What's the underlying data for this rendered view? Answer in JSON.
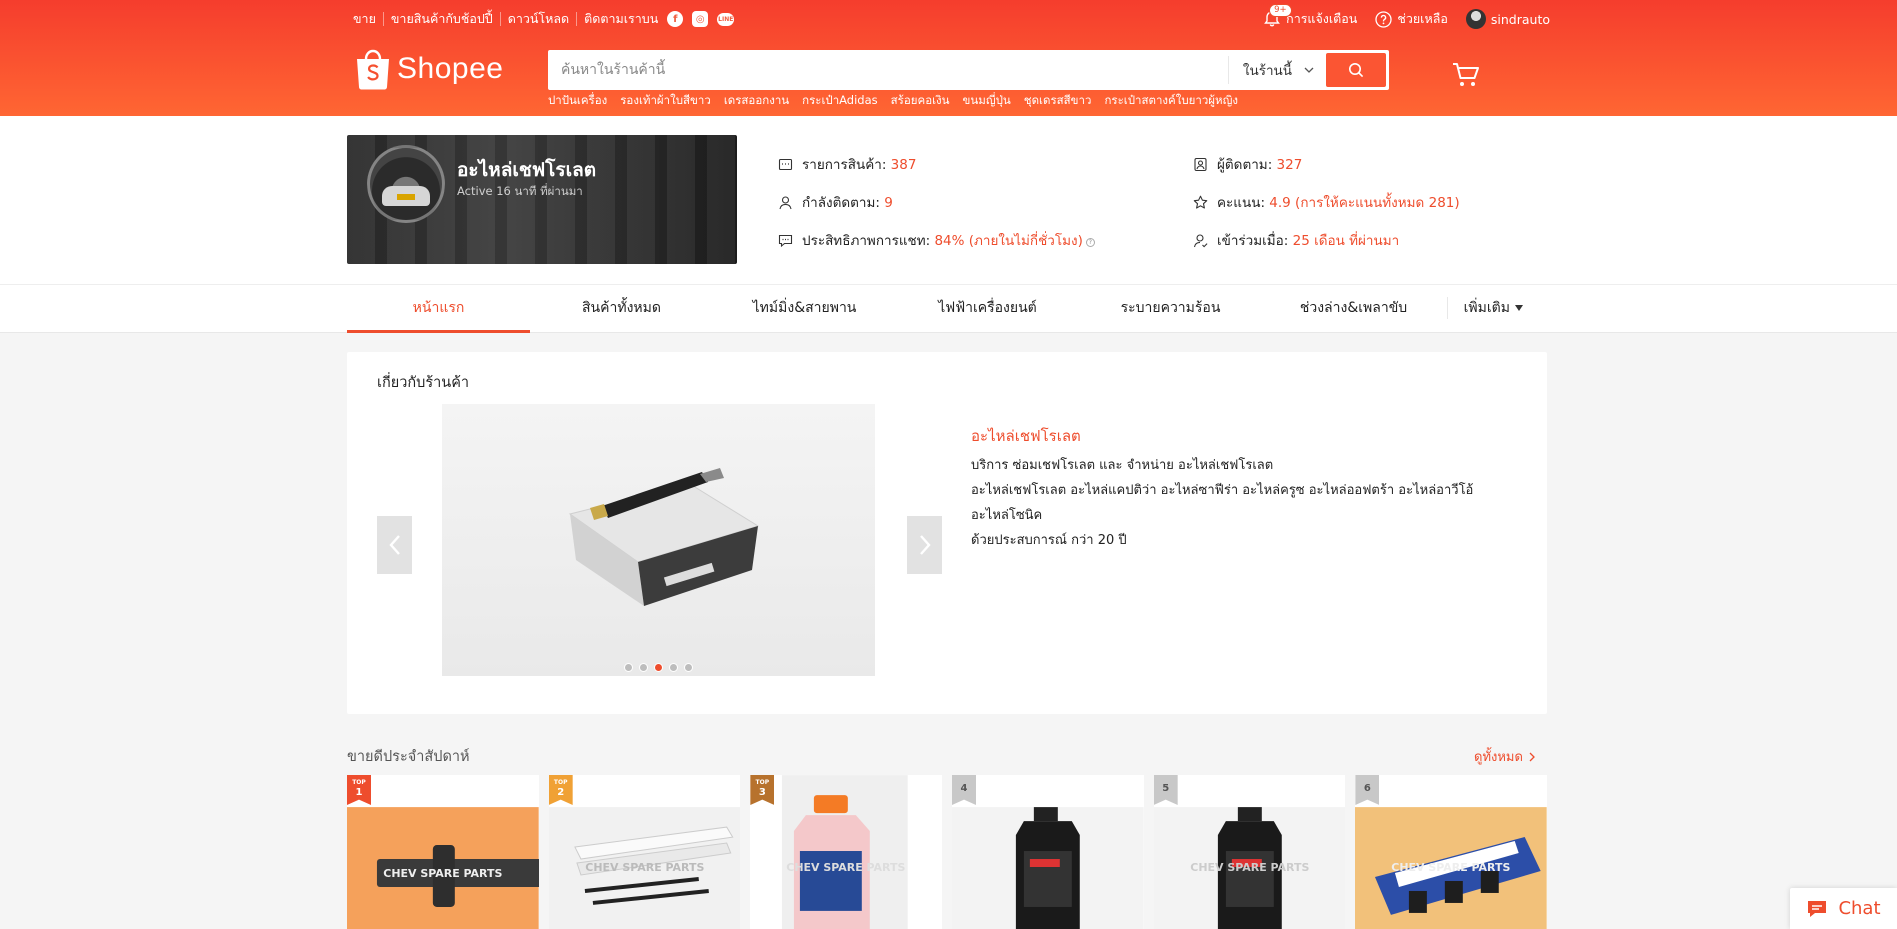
{
  "topbar": {
    "links": [
      "ขาย",
      "ขายสินค้ากับช้อปปี้",
      "ดาวน์โหลด"
    ],
    "follow_label": "ติดตามเราบน",
    "notifications_label": "การแจ้งเตือน",
    "notifications_badge": "9+",
    "help_label": "ช่วยเหลือ",
    "username": "sindrauto"
  },
  "logo": {
    "text": "Shopee"
  },
  "search": {
    "placeholder": "ค้นหาในร้านค้านี้",
    "scope": "ในร้านนี้",
    "hot_words": [
      "ปาปันเครื่อง",
      "รองเท้าผ้าใบสีขาว",
      "เดรสออกงาน",
      "กระเป๋าAdidas",
      "สร้อยคอเงิน",
      "ขนมญี่ปุ่น",
      "ชุดเดรสสีขาว",
      "กระเป๋าสตางค์ใบยาวผู้หญิง"
    ]
  },
  "shop": {
    "name": "อะไหล่เชฟโรเลต",
    "active": "Active 16 นาที ที่ผ่านมา",
    "stats": {
      "products_label": "รายการสินค้า:",
      "products_value": "387",
      "following_label": "กำลังติดตาม:",
      "following_value": "9",
      "chat_label": "ประสิทธิภาพการแชท:",
      "chat_value": "84% (ภายในไม่กี่ชั่วโมง)",
      "followers_label": "ผู้ติดตาม:",
      "followers_value": "327",
      "rating_label": "คะแนน:",
      "rating_value": "4.9 (การให้คะแนนทั้งหมด 281)",
      "joined_label": "เข้าร่วมเมื่อ:",
      "joined_value": "25 เดือน ที่ผ่านมา"
    }
  },
  "tabs": {
    "items": [
      "หน้าแรก",
      "สินค้าทั้งหมด",
      "ไทม์มิ่ง&สายพาน",
      "ไฟฟ้าเครื่องยนต์",
      "ระบายความร้อน",
      "ช่วงล่าง&เพลาขับ"
    ],
    "more": "เพิ่มเติม"
  },
  "about": {
    "title": "เกี่ยวกับร้านค้า",
    "shop_title": "อะไหล่เชฟโรเลต",
    "lines": [
      "บริการ ซ่อมเชฟโรเลต และ จำหน่าย อะไหล่เชฟโรเลต",
      "อะไหล่เชฟโรเลต อะไหล่แคปติว่า อะไหล่ซาฟีร่า อะไหล่ครูซ อะไหล่ออฟตร้า อะไหล่อาวีโอ้",
      "อะไหล่โซนิค",
      "ด้วยประสบการณ์ กว่า 20 ปี"
    ],
    "slide_index": 3,
    "slide_count": 5
  },
  "top_sales": {
    "title": "ขายดีประจำสัปดาห์",
    "view_all": "ดูทั้งหมด",
    "top_label": "TOP",
    "ranks": [
      "1",
      "2",
      "3",
      "4",
      "5",
      "6"
    ],
    "watermark": "CHEV SPARE PARTS"
  },
  "chat": {
    "label": "Chat"
  },
  "colors": {
    "brand": "#ee4d2d",
    "header_from": "#f53d2d",
    "header_to": "#ff6633"
  }
}
